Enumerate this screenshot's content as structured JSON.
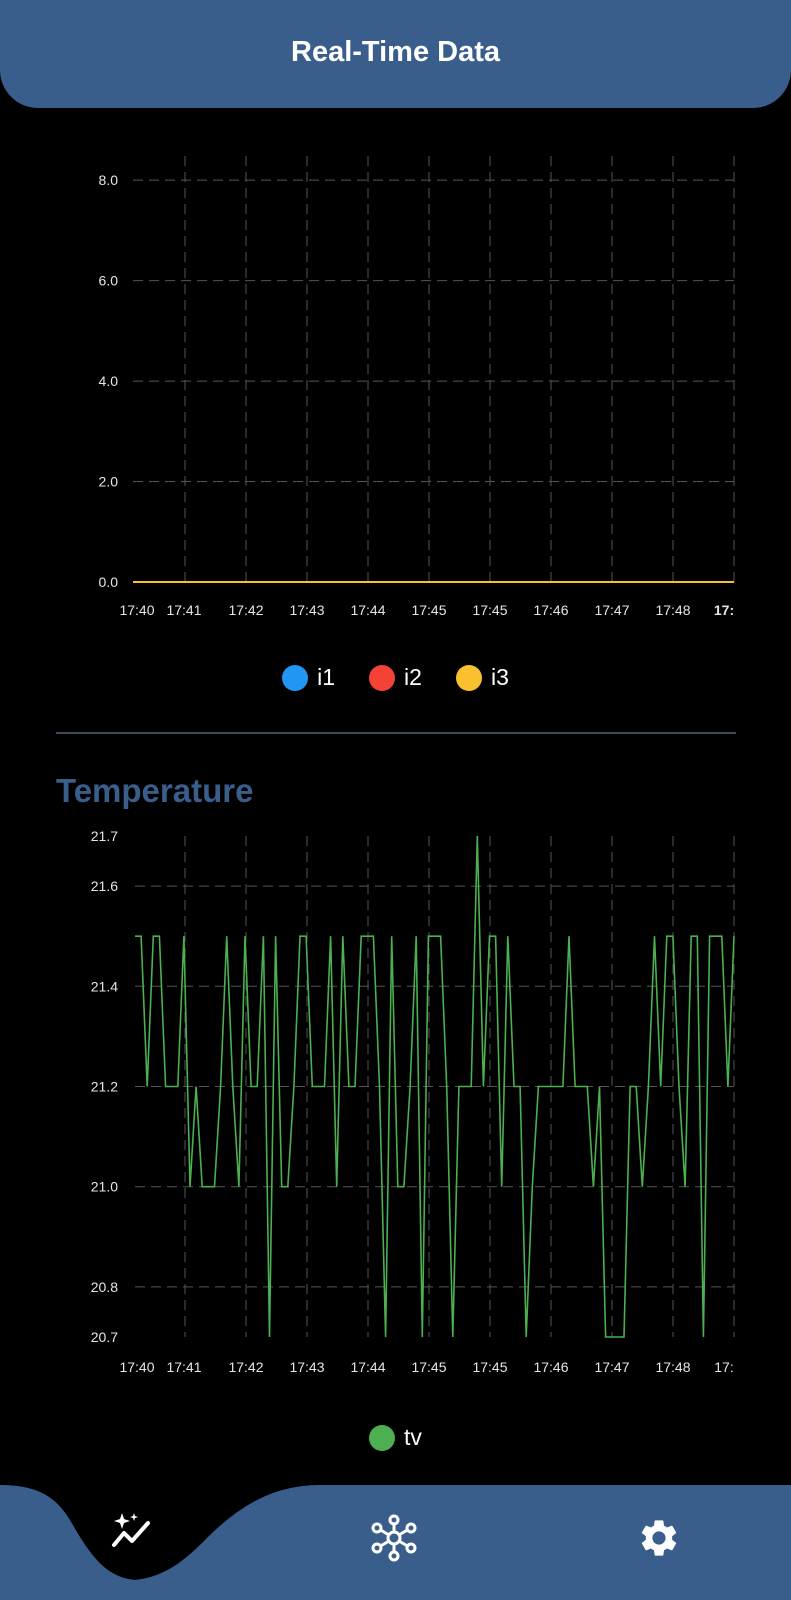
{
  "header": {
    "title": "Real-Time Data"
  },
  "colors": {
    "primary": "#3a5e8c",
    "i1": "#2196f3",
    "i2": "#f44336",
    "i3": "#fbc02d",
    "tv": "#4caf50"
  },
  "current_chart": {
    "legend": [
      {
        "label": "i1",
        "color": "#2196f3"
      },
      {
        "label": "i2",
        "color": "#f44336"
      },
      {
        "label": "i3",
        "color": "#fbc02d"
      }
    ]
  },
  "temperature": {
    "title": "Temperature"
  },
  "nav": [
    {
      "name": "nav-realtime-data",
      "icon": "chart-sparkle-icon",
      "active": true
    },
    {
      "name": "nav-network",
      "icon": "network-hub-icon",
      "active": false
    },
    {
      "name": "nav-settings",
      "icon": "gear-icon",
      "active": false
    }
  ],
  "chart_data": [
    {
      "type": "line",
      "title": "",
      "x_tick_labels": [
        "17:40",
        "17:41",
        "17:42",
        "17:43",
        "17:44",
        "17:45",
        "17:45",
        "17:46",
        "17:47",
        "17:48",
        "17:"
      ],
      "y_tick_labels": [
        "0.0",
        "2.0",
        "4.0",
        "6.0",
        "8.0"
      ],
      "ylim": [
        0,
        8.8
      ],
      "grid": true,
      "legend_position": "bottom",
      "series": [
        {
          "name": "i1",
          "color": "#2196f3",
          "values": [
            0,
            0,
            0,
            0,
            0,
            0,
            0,
            0,
            0,
            0,
            0,
            0
          ]
        },
        {
          "name": "i2",
          "color": "#f44336",
          "values": [
            0,
            0,
            0,
            0,
            0,
            0,
            0,
            0,
            0,
            0,
            0,
            0
          ]
        },
        {
          "name": "i3",
          "color": "#fbc02d",
          "values": [
            0,
            0,
            0,
            0,
            0,
            0,
            0,
            0,
            0,
            0,
            0,
            0
          ]
        }
      ]
    },
    {
      "type": "line",
      "title": "",
      "x_tick_labels": [
        "17:40",
        "17:41",
        "17:42",
        "17:43",
        "17:44",
        "17:45",
        "17:45",
        "17:46",
        "17:47",
        "17:48",
        "17:"
      ],
      "y_tick_labels": [
        "20.7",
        "20.8",
        "21.0",
        "21.2",
        "21.4",
        "21.6",
        "21.7"
      ],
      "ylim": [
        20.7,
        21.7
      ],
      "grid": true,
      "legend_position": "bottom",
      "series": [
        {
          "name": "tv",
          "color": "#4caf50",
          "values": [
            21.5,
            21.5,
            21.2,
            21.5,
            21.5,
            21.2,
            21.2,
            21.2,
            21.5,
            21.0,
            21.2,
            21.0,
            21.0,
            21.0,
            21.2,
            21.5,
            21.2,
            21.0,
            21.5,
            21.2,
            21.2,
            21.5,
            20.7,
            21.5,
            21.0,
            21.0,
            21.2,
            21.5,
            21.5,
            21.2,
            21.2,
            21.2,
            21.5,
            21.0,
            21.5,
            21.2,
            21.2,
            21.5,
            21.5,
            21.5,
            21.2,
            20.7,
            21.5,
            21.0,
            21.0,
            21.2,
            21.5,
            20.7,
            21.5,
            21.5,
            21.5,
            21.2,
            20.7,
            21.2,
            21.2,
            21.2,
            21.7,
            21.2,
            21.5,
            21.5,
            21.0,
            21.5,
            21.2,
            21.2,
            20.7,
            21.0,
            21.2,
            21.2,
            21.2,
            21.2,
            21.2,
            21.5,
            21.2,
            21.2,
            21.2,
            21.0,
            21.2,
            20.7,
            20.7,
            20.7,
            20.7,
            21.2,
            21.2,
            21.0,
            21.2,
            21.5,
            21.2,
            21.5,
            21.5,
            21.2,
            21.0,
            21.5,
            21.5,
            20.7,
            21.5,
            21.5,
            21.5,
            21.2,
            21.5
          ]
        }
      ]
    }
  ]
}
